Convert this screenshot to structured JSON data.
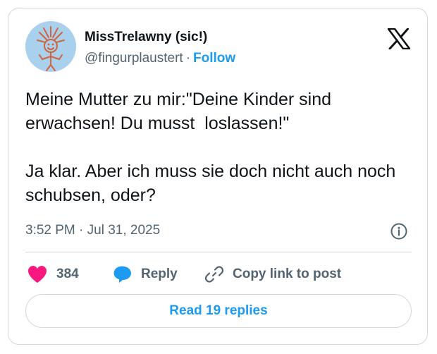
{
  "author": {
    "name": "MissTrelawny (sic!)",
    "handle": "@fingurplaustert",
    "separator": "·",
    "follow_label": "Follow",
    "avatar_icon": "stick-figure-drawing-avatar"
  },
  "platform": {
    "logo_icon": "x-logo-icon"
  },
  "post": {
    "paragraphs": [
      "Meine Mutter zu mir:\"Deine Kinder sind erwachsen! Du musst  loslassen!\"",
      "Ja klar. Aber ich muss sie doch nicht auch noch schubsen, oder?"
    ],
    "timestamp": "3:52 PM · Jul 31, 2025",
    "info_icon": "info-icon"
  },
  "actions": {
    "like_count": "384",
    "reply_label": "Reply",
    "copy_link_label": "Copy link to post",
    "read_replies_label": "Read 19 replies"
  },
  "colors": {
    "like": "#f91880",
    "accent": "#1d9bf0",
    "text": "#0f1419",
    "secondary": "#536471",
    "border": "#cfd9de"
  }
}
